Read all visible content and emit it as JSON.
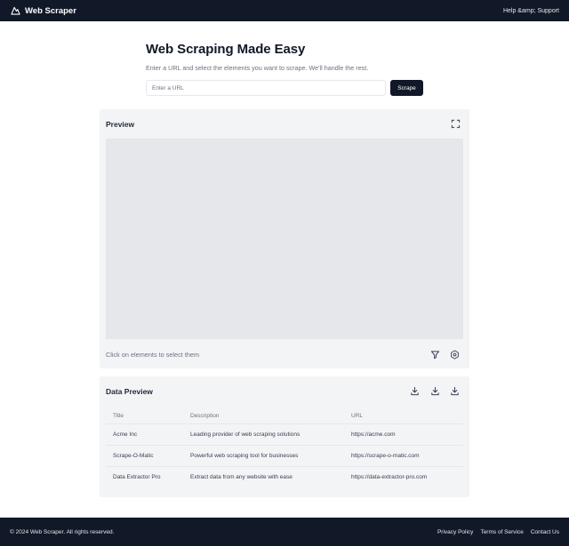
{
  "header": {
    "brand": "Web Scraper",
    "brand_icon": "mountain-icon",
    "help_link": "Help &amp; Support"
  },
  "hero": {
    "title": "Web Scraping Made Easy",
    "subtitle": "Enter a URL and select the elements you want to scrape. We'll handle the rest.",
    "url_placeholder": "Enter a URL",
    "url_value": "",
    "scrape_label": "Scrape"
  },
  "preview": {
    "title": "Preview",
    "hint": "Click on elements to select them",
    "icons": [
      "expand-icon",
      "filter-icon",
      "settings-icon"
    ]
  },
  "data_preview": {
    "title": "Data Preview",
    "icons": [
      "download-icon",
      "download-icon",
      "download-icon"
    ],
    "columns": [
      "Title",
      "Description",
      "URL"
    ],
    "rows": [
      [
        "Acme Inc",
        "Leading provider of web scraping solutions",
        "https://acme.com"
      ],
      [
        "Scrape-O-Matic",
        "Powerful web scraping tool for businesses",
        "https://scrape-o-matic.com"
      ],
      [
        "Data Extractor Pro",
        "Extract data from any website with ease",
        "https://data-extractor-pro.com"
      ]
    ]
  },
  "footer": {
    "copyright": "© 2024 Web Scraper. All rights reserved.",
    "links": [
      "Privacy Policy",
      "Terms of Service",
      "Contact Us"
    ]
  },
  "colors": {
    "header_bg": "#111827",
    "card_bg": "#f3f4f6",
    "canvas_bg": "#e5e7eb",
    "button_bg": "#111827",
    "muted_text": "#6b7280"
  }
}
